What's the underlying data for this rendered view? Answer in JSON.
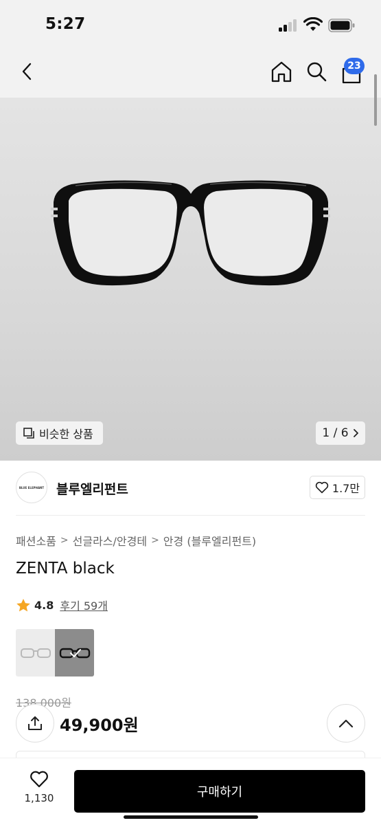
{
  "status_bar": {
    "time": "5:27"
  },
  "nav": {
    "cart_badge": "23"
  },
  "gallery": {
    "similar_label": "비슷한 상품",
    "pager": "1 / 6"
  },
  "brand": {
    "logo_text": "BLUE ELEPHANT",
    "name": "블루엘리펀트",
    "likes": "1.7만"
  },
  "product": {
    "breadcrumb": [
      "패션소품",
      "선글라스/안경테",
      "안경 (블루엘리펀트)"
    ],
    "title": "ZENTA black",
    "rating": "4.8",
    "reviews": "후기 59개",
    "original_price": "138,000원",
    "sale_price": "49,900원"
  },
  "bottom_bar": {
    "wish_count": "1,130",
    "buy_label": "구매하기"
  },
  "colors": {
    "accent": "#2f6bea",
    "star": "#f5a623",
    "buy_button": "#000000"
  }
}
